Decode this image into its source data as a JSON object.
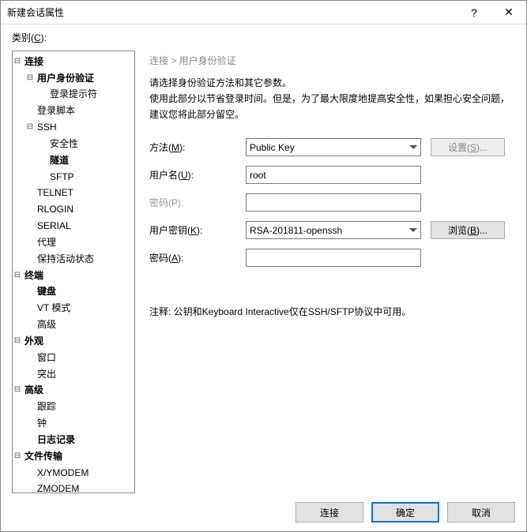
{
  "window": {
    "title": "新建会话属性",
    "help": "?",
    "close": "✕"
  },
  "category_label_pre": "类别(",
  "category_label_key": "C",
  "category_label_post": "):",
  "tree": {
    "items": [
      {
        "label": "连接",
        "bold": true,
        "children": [
          {
            "label": "用户身份验证",
            "bold": true,
            "children": [
              {
                "label": "登录提示符"
              }
            ]
          },
          {
            "label": "登录脚本"
          },
          {
            "label": "SSH",
            "children": [
              {
                "label": "安全性"
              },
              {
                "label": "隧道",
                "bold": true
              },
              {
                "label": "SFTP"
              }
            ]
          },
          {
            "label": "TELNET"
          },
          {
            "label": "RLOGIN"
          },
          {
            "label": "SERIAL"
          },
          {
            "label": "代理"
          },
          {
            "label": "保持活动状态"
          }
        ]
      },
      {
        "label": "终端",
        "bold": true,
        "children": [
          {
            "label": "键盘",
            "bold": true
          },
          {
            "label": "VT 模式"
          },
          {
            "label": "高级"
          }
        ]
      },
      {
        "label": "外观",
        "bold": true,
        "children": [
          {
            "label": "窗口"
          },
          {
            "label": "突出"
          }
        ]
      },
      {
        "label": "高级",
        "bold": true,
        "children": [
          {
            "label": "跟踪"
          },
          {
            "label": "钟"
          },
          {
            "label": "日志记录",
            "bold": true
          }
        ]
      },
      {
        "label": "文件传输",
        "bold": true,
        "children": [
          {
            "label": "X/YMODEM"
          },
          {
            "label": "ZMODEM"
          }
        ]
      }
    ]
  },
  "breadcrumb": "连接 > 用户身份验证",
  "desc1": "请选择身份验证方法和其它参数。",
  "desc2": "使用此部分以节省登录时间。但是，为了最大限度地提高安全性，如果担心安全问题，建议您将此部分留空。",
  "labels": {
    "method_pre": "方法(",
    "method_key": "M",
    "method_post": "):",
    "user_pre": "用户名(",
    "user_key": "U",
    "user_post": "):",
    "pass_pre": "密码(",
    "pass_key": "P",
    "pass_post": "):",
    "key_pre": "用户密钥(",
    "key_key": "K",
    "key_post": "):",
    "pass2_pre": "密码(",
    "pass2_key": "A",
    "pass2_post": "):",
    "settings_pre": "设置(",
    "settings_key": "S",
    "settings_post": ")...",
    "browse_pre": "浏览(",
    "browse_key": "B",
    "browse_post": ")..."
  },
  "values": {
    "method": "Public Key",
    "user": "root",
    "pass": "",
    "key": "RSA-201811-openssh",
    "pass2": ""
  },
  "note": "注释: 公钥和Keyboard Interactive仅在SSH/SFTP协议中可用。",
  "footer": {
    "connect": "连接",
    "ok": "确定",
    "cancel": "取消"
  }
}
